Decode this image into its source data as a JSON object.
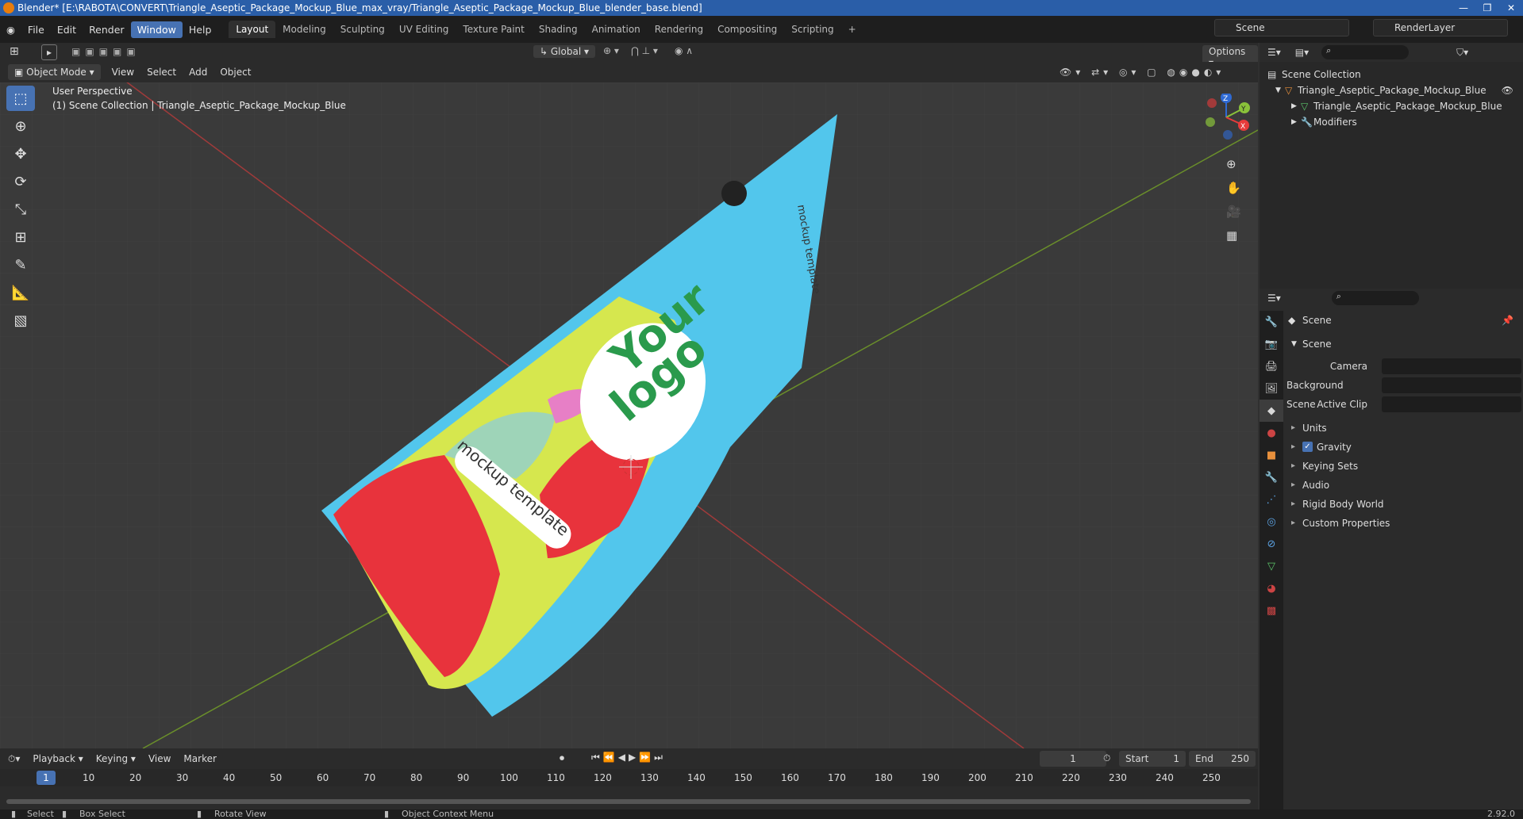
{
  "window": {
    "title": "Blender* [E:\\RABOTA\\CONVERT\\Triangle_Aseptic_Package_Mockup_Blue_max_vray/Triangle_Aseptic_Package_Mockup_Blue_blender_base.blend]"
  },
  "menu": [
    "File",
    "Edit",
    "Render",
    "Window",
    "Help"
  ],
  "workspaces": [
    "Layout",
    "Modeling",
    "Sculpting",
    "UV Editing",
    "Texture Paint",
    "Shading",
    "Animation",
    "Rendering",
    "Compositing",
    "Scripting"
  ],
  "scene_selector": {
    "value": "Scene"
  },
  "renderlayer_selector": {
    "value": "RenderLayer"
  },
  "viewport_header": {
    "transform_orientation": "Global",
    "options_label": "Options",
    "mode": "Object Mode",
    "menus": [
      "View",
      "Select",
      "Add",
      "Object"
    ]
  },
  "viewport": {
    "perspective": "User Perspective",
    "collection_info": "(1) Scene Collection | Triangle_Aseptic_Package_Mockup_Blue",
    "package_text_logo_1": "Your",
    "package_text_logo_2": "logo",
    "package_text_band": "mockup template",
    "package_text_side": "mockup template",
    "axes": {
      "z": "Z",
      "y": "Y",
      "x": "X"
    }
  },
  "outliner": {
    "root": "Scene Collection",
    "items": [
      {
        "label": "Triangle_Aseptic_Package_Mockup_Blue",
        "level": 1
      },
      {
        "label": "Triangle_Aseptic_Package_Mockup_Blue",
        "level": 2
      },
      {
        "label": "Modifiers",
        "level": 2
      }
    ]
  },
  "properties": {
    "context": "Scene",
    "section": "Scene",
    "fields": [
      {
        "label": "Camera"
      },
      {
        "label": "Background Scene"
      },
      {
        "label": "Active Clip"
      }
    ],
    "panels": [
      "Units",
      "Gravity",
      "Keying Sets",
      "Audio",
      "Rigid Body World",
      "Custom Properties"
    ],
    "gravity_checked": true
  },
  "timeline": {
    "menus": [
      "Playback",
      "Keying",
      "View",
      "Marker"
    ],
    "current_frame": "1",
    "start_label": "Start",
    "start": "1",
    "end_label": "End",
    "end": "250",
    "ticks": [
      "1",
      "10",
      "20",
      "30",
      "40",
      "50",
      "60",
      "70",
      "80",
      "90",
      "100",
      "110",
      "120",
      "130",
      "140",
      "150",
      "160",
      "170",
      "180",
      "190",
      "200",
      "210",
      "220",
      "230",
      "240",
      "250"
    ]
  },
  "statusbar": {
    "select": "Select",
    "box_select": "Box Select",
    "rotate_view": "Rotate View",
    "context_menu": "Object Context Menu",
    "version": "2.92.0"
  }
}
